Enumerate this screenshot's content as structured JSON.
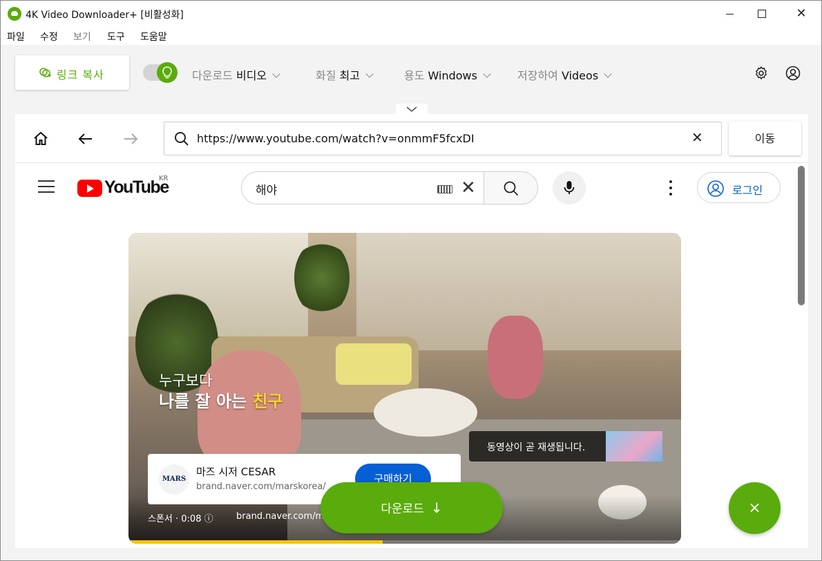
{
  "window": {
    "title": "4K Video Downloader+ [비활성화]",
    "minimize_icon": "minimize-icon",
    "maximize_icon": "maximize-icon",
    "close_glyph": "✕"
  },
  "menu": {
    "items": [
      {
        "label": "파일",
        "enabled": true
      },
      {
        "label": "수정",
        "enabled": true
      },
      {
        "label": "보기",
        "enabled": false
      },
      {
        "label": "도구",
        "enabled": true
      },
      {
        "label": "도움말",
        "enabled": true
      }
    ]
  },
  "toolbar": {
    "paste_link_label": "링크 복사",
    "smart_mode_icon": "lightbulb-icon",
    "download_prefix": "다운로드",
    "download_value": "비디오",
    "quality_prefix": "화질",
    "quality_value": "최고",
    "purpose_prefix": "용도",
    "purpose_value": "Windows",
    "save_prefix": "저장하여",
    "save_value": "Videos",
    "accent_color": "#5aab0c"
  },
  "browser": {
    "url": "https://www.youtube.com/watch?v=onmmF5fcxDI",
    "clear_glyph": "✕",
    "go_label": "이동"
  },
  "youtube": {
    "logo_text": "YouTube",
    "region": "KR",
    "search_query": "해야",
    "clear_glyph": "✕",
    "login_label": "로그인",
    "video": {
      "ad_headline_line1": "누구보다",
      "ad_headline_line2_pre": "나를 잘 아는 ",
      "ad_headline_line2_hl": "친구",
      "up_next": "동영상이 곧 재생됩니다.",
      "ad_logo_text": "MARS",
      "ad_name": "마즈 시저 CESAR",
      "ad_domain": "brand.naver.com/marskorea/",
      "ad_cta": "구매하기",
      "sponsor_label": "스폰서 · 0:08 ⓘ",
      "sponsor_url": "brand.naver.com/m",
      "progress": 0.46
    }
  },
  "download_button": {
    "label": "다운로드",
    "arrow": "↓"
  },
  "fab_glyph": "×"
}
